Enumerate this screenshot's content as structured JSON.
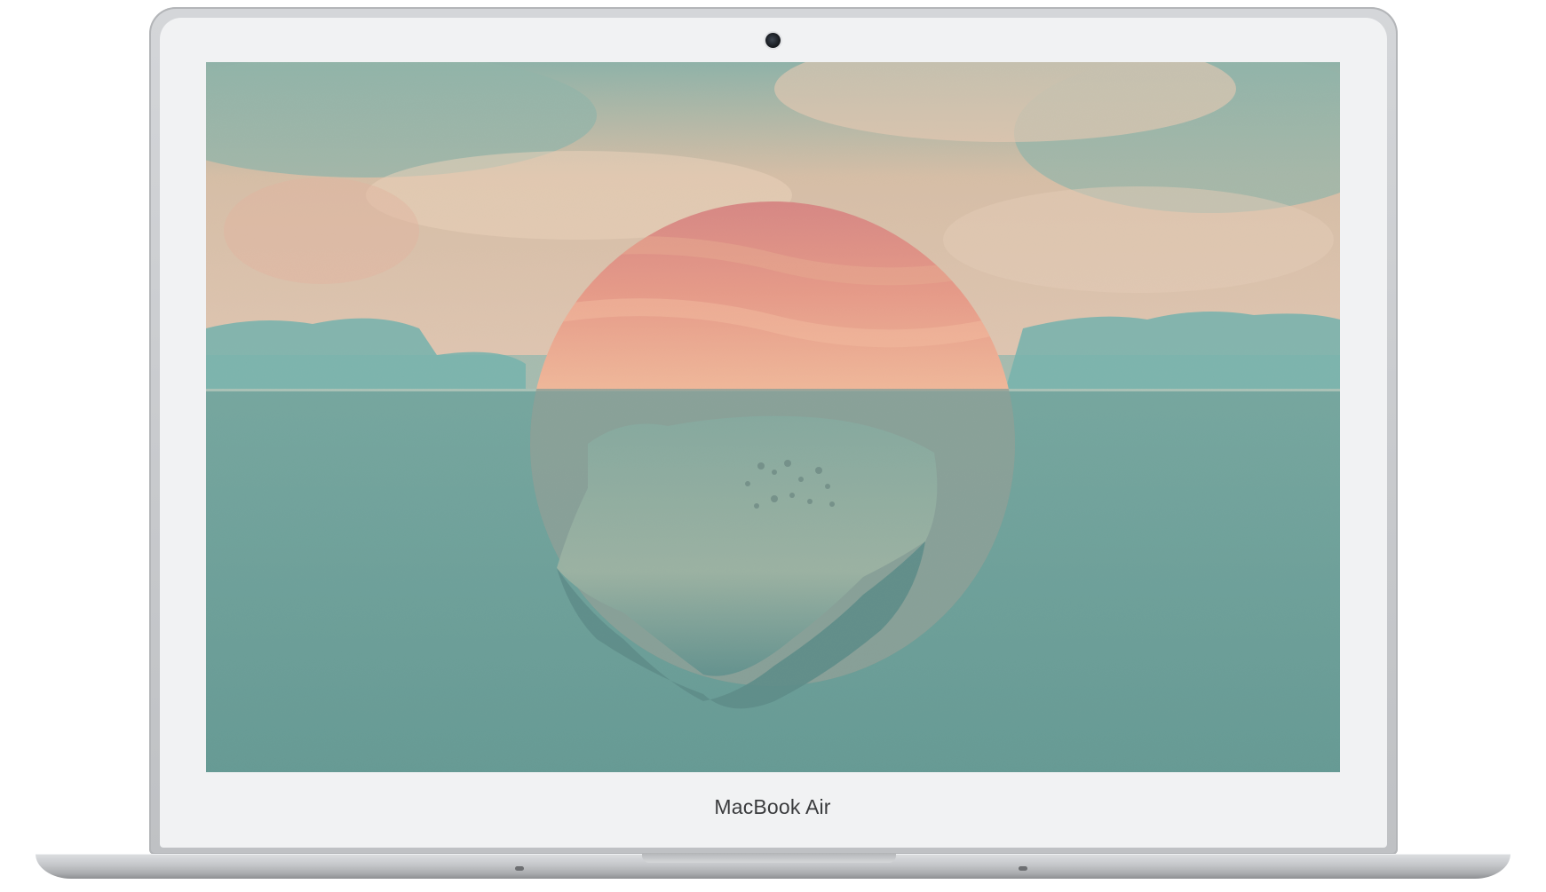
{
  "device": {
    "brand_label": "MacBook Air"
  },
  "wallpaper": {
    "subject": "sun-over-sea-landscape",
    "colors": {
      "sky": "#c9a98a",
      "sky_teal": "#6b9a8c",
      "sun_top": "#c85f5c",
      "sun_bottom": "#e8916a",
      "sea": "#3d7f77",
      "mountains": "#4f9a92"
    }
  }
}
